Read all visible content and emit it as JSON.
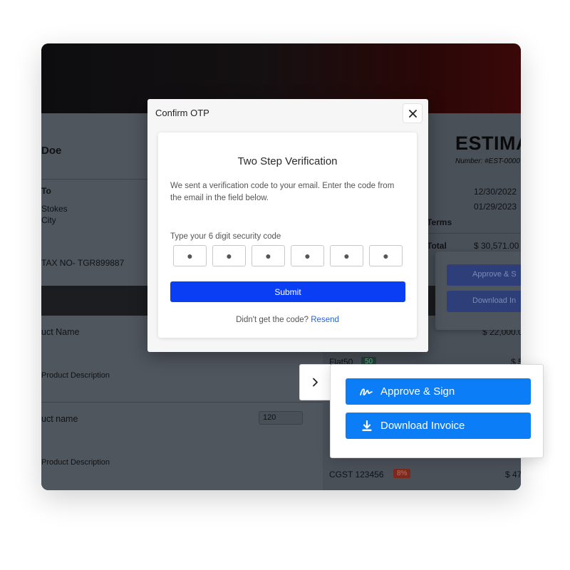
{
  "invoice": {
    "customer_name": "Doe",
    "to_label": "To",
    "address_line1": "Stokes",
    "address_line2": "City",
    "tax_no": "TAX NO- TGR899887",
    "title": "ESTIMA",
    "number": "Number: #EST-0000",
    "date1": "12/30/2022",
    "date2": "01/29/2023",
    "terms_label": "Terms",
    "total_label": "Total",
    "total_value": "$ 30,571.00",
    "items": [
      {
        "name": "uct Name",
        "description": "Product Description",
        "amount": "$ 22,000.0"
      },
      {
        "name": "uct name",
        "description": "Product Description",
        "qty": "120"
      }
    ],
    "discount_label": "Flat50",
    "discount_chip": "50",
    "discount_amount": "$ 5",
    "tax_label": "CGST 123456",
    "tax_chip": "8%",
    "tax_amount": "$ 47",
    "side_marker": "I",
    "ghost_approve": "Approve & S",
    "ghost_download": "Download In"
  },
  "modal": {
    "title": "Confirm OTP",
    "heading": "Two Step Verification",
    "description": "We sent a verification code to your email. Enter the code from the email in the field below.",
    "code_label": "Type your 6 digit security code",
    "otp": [
      "●",
      "●",
      "●",
      "●",
      "●",
      "●"
    ],
    "submit_label": "Submit",
    "resend_prompt": "Didn't get the code?",
    "resend_link": "Resend"
  },
  "actions": {
    "approve_label": "Approve & Sign",
    "download_label": "Download Invoice"
  },
  "colors": {
    "submit": "#0a3ef5",
    "action": "#0b7df7",
    "link": "#2a62d8"
  },
  "icons": {
    "close": "close-icon",
    "chevron": "chevron-right-icon",
    "signature": "signature-icon",
    "download": "download-icon"
  }
}
